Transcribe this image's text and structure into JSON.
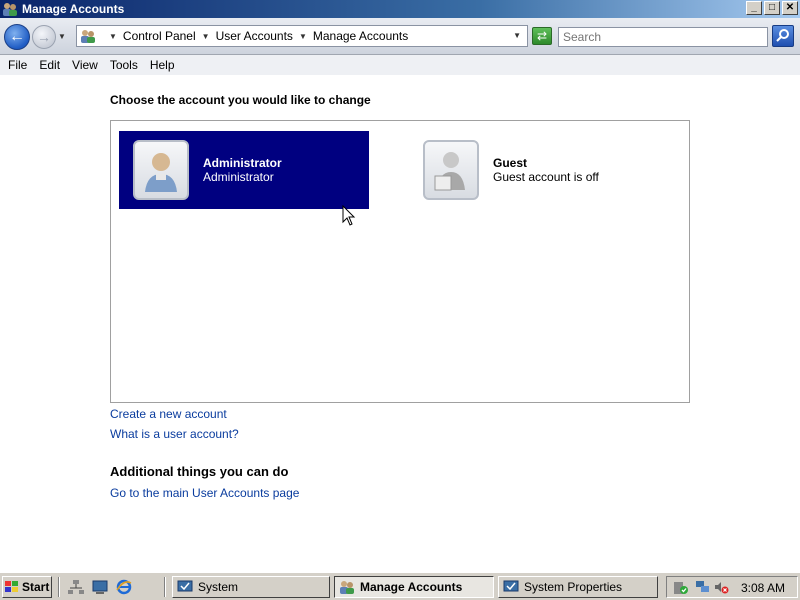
{
  "window": {
    "title": "Manage Accounts",
    "app_icon": "users-icon",
    "controls": {
      "minimize": "_",
      "maximize": "□",
      "close": "✕"
    }
  },
  "address_bar": {
    "breadcrumb": [
      "Control Panel",
      "User Accounts",
      "Manage Accounts"
    ],
    "search_placeholder": "Search",
    "back_icon": "back-arrow-icon",
    "forward_icon": "forward-arrow-icon",
    "refresh_icon": "refresh-icon",
    "search_icon": "magnifier-icon"
  },
  "menu": {
    "items": [
      "File",
      "Edit",
      "View",
      "Tools",
      "Help"
    ]
  },
  "main": {
    "heading": "Choose the account you would like to change",
    "accounts": [
      {
        "name": "Administrator",
        "description": "Administrator",
        "selected": true,
        "icon": "admin-user-icon"
      },
      {
        "name": "Guest",
        "description": "Guest account is off",
        "selected": false,
        "icon": "guest-user-icon"
      }
    ],
    "links": {
      "create_account": "Create a new account",
      "what_is_account": "What is a user account?"
    },
    "additional": {
      "title": "Additional things you can do",
      "main_page_link": "Go to the main User Accounts page"
    }
  },
  "taskbar": {
    "start_label": "Start",
    "tasks": [
      {
        "label": "System",
        "active": false
      },
      {
        "label": "Manage Accounts",
        "active": true
      },
      {
        "label": "System Properties",
        "active": false
      }
    ],
    "clock": "3:08 AM"
  },
  "colors": {
    "selection": "#000080",
    "link": "#0a3c9e",
    "titlebar_start": "#0a246a",
    "taskbar": "#d4d0c8"
  }
}
